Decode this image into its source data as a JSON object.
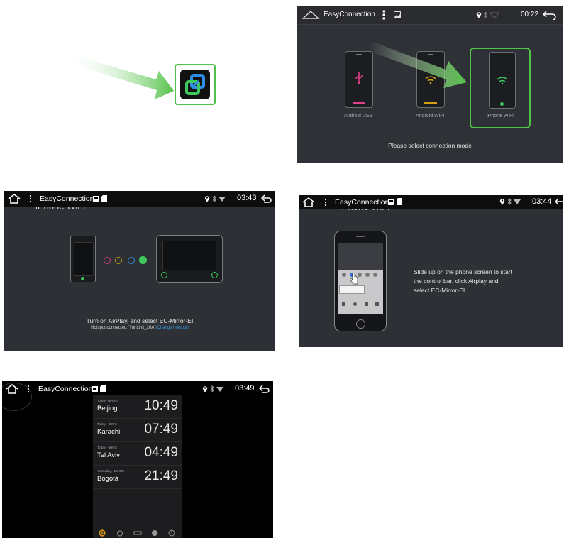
{
  "app": {
    "title": "EasyConnection"
  },
  "panel1": {
    "icon": "easyconnection-app-icon"
  },
  "panel2": {
    "time": "00:22",
    "modes": [
      {
        "label": "Android USB",
        "icon": "usb-icon",
        "color": "#e0408a"
      },
      {
        "label": "Android WiFi",
        "icon": "wifi-icon",
        "color": "#d4a012"
      },
      {
        "label": "iPhone WiFi",
        "icon": "wifi-icon",
        "color": "#3ec95e"
      }
    ],
    "prompt": "Please select connection mode"
  },
  "panel3": {
    "time": "03:43",
    "heading": "iPhone WiFi",
    "instruction": "Turn on AirPlay, and select EC-Mirror-EI",
    "hotspot_text": "Hotspot connected:\"YunLink_26A\"",
    "change_hotspot": "(Change hotspot)"
  },
  "panel4": {
    "time": "03:44",
    "heading": "iPhone WiFi",
    "instruction_lines": [
      "Slide up on the phone screen to start",
      "the control bar, click Airplay and",
      "select EC-Mirror-EI"
    ]
  },
  "panel5": {
    "time": "03:49",
    "clocks": [
      {
        "sub": "Today, +8HRS",
        "city": "Beijing",
        "time": "10:49"
      },
      {
        "sub": "Today, -3HRS",
        "city": "Karachi",
        "time": "07:49"
      },
      {
        "sub": "Today, -6HRS",
        "city": "Tel Aviv",
        "time": "04:49"
      },
      {
        "sub": "Yesterday, -13HRS",
        "city": "Bogotá",
        "time": "21:49"
      }
    ]
  },
  "colors": {
    "accent_green": "#3ec95e",
    "link_blue": "#3a9ad9",
    "bg_dark": "#2d3035"
  }
}
